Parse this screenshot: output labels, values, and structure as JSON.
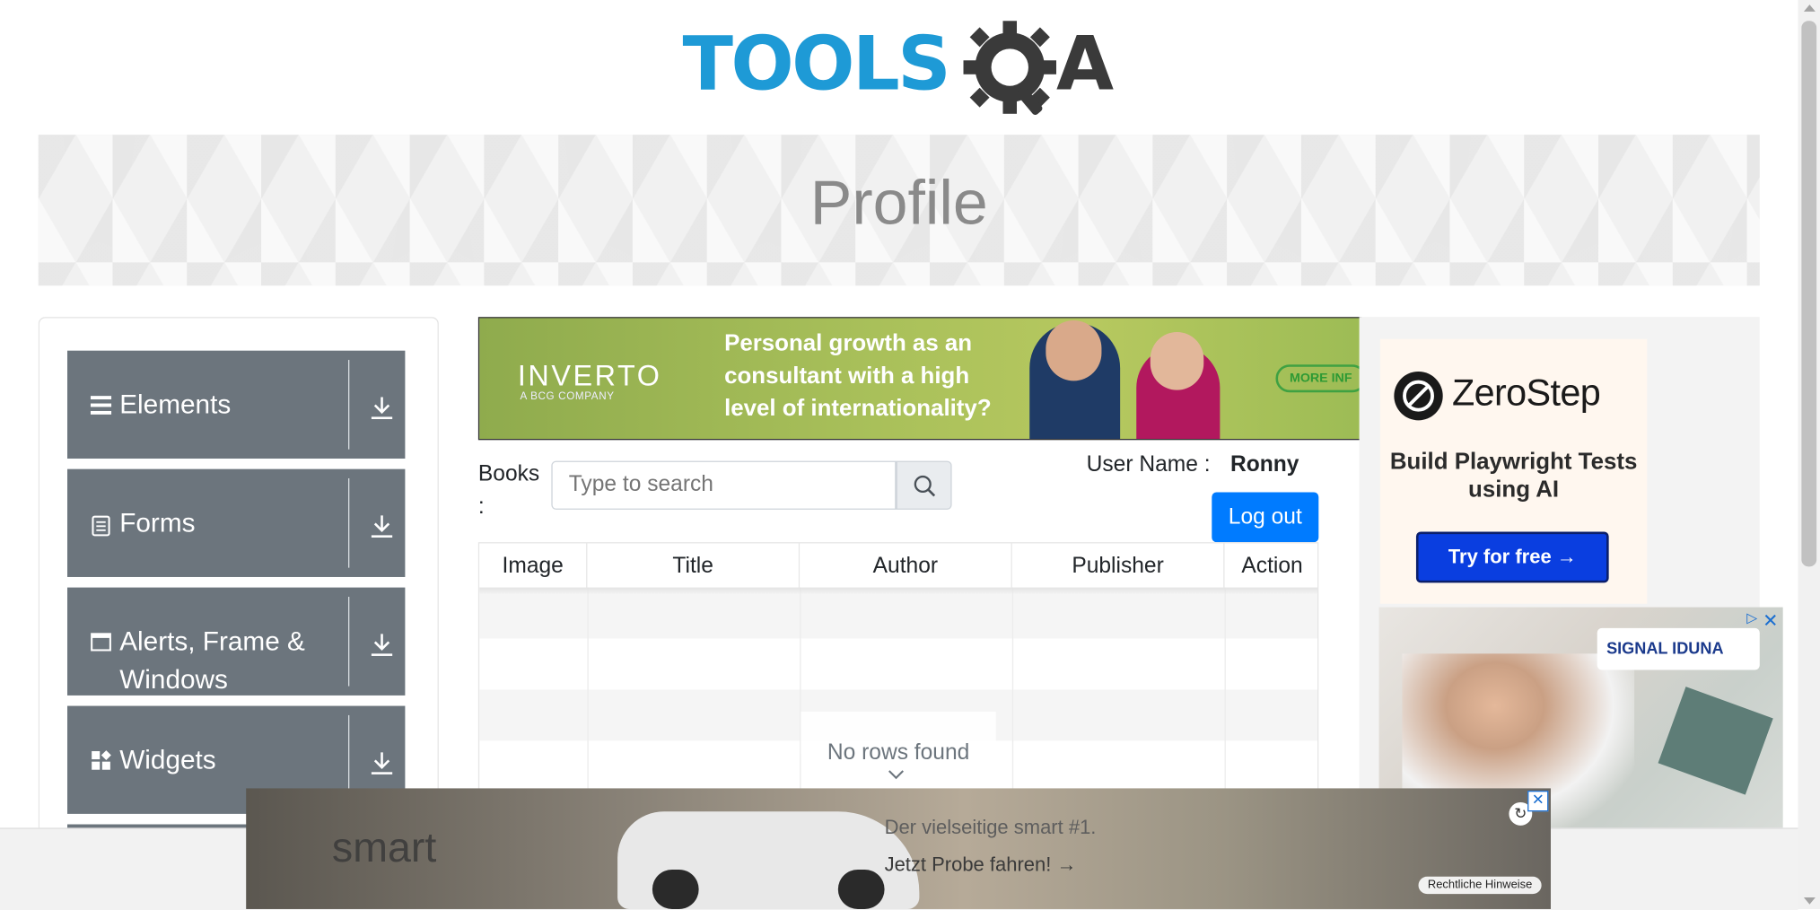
{
  "header": {
    "logo_text_left": "TOOLS",
    "logo_text_right": "A"
  },
  "banner": {
    "title": "Profile"
  },
  "sidebar": {
    "groups": [
      {
        "label": "Elements",
        "icon": "list-icon"
      },
      {
        "label": "Forms",
        "icon": "document-icon"
      },
      {
        "label": "Alerts, Frame & Windows",
        "icon": "window-icon"
      },
      {
        "label": "Widgets",
        "icon": "widgets-icon"
      }
    ]
  },
  "ads": {
    "inverto": {
      "brand": "INVERTO",
      "sub": "A BCG COMPANY",
      "text": "Personal growth as an consultant with a high level of internationality?",
      "cta": "MORE INF"
    },
    "zerostep": {
      "name": "ZeroStep",
      "tagline": "Build Playwright Tests using AI",
      "cta": "Try for free →"
    },
    "signal": {
      "brand": "SIGNAL IDUNA"
    },
    "smart": {
      "brand": "smart",
      "line1": "Der vielseitige smart #1.",
      "line2": "Jetzt Probe fahren! →",
      "legal": "Rechtliche Hinweise"
    }
  },
  "books": {
    "label": "Books :",
    "search_placeholder": "Type to search",
    "user_label": "User Name :",
    "user_value": "Ronny",
    "logout": "Log out",
    "columns": [
      "Image",
      "Title",
      "Author",
      "Publisher",
      "Action"
    ],
    "empty_text": "No rows found"
  },
  "colors": {
    "accent": "#007bff",
    "sidebar_header": "#6c757d",
    "logo_blue": "#1e9ad6"
  }
}
